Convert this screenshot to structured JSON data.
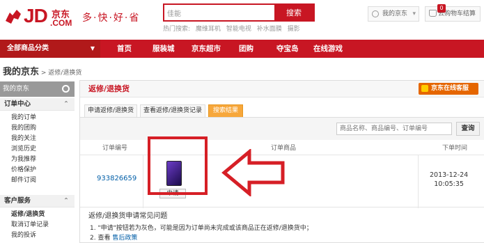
{
  "header": {
    "logo_text": "JD",
    "logo_cn": "京东",
    "logo_com": ".COM",
    "slogan": "多·快·好·省",
    "search_value": "佳能",
    "search_button": "搜索",
    "hot_label": "热门搜索:",
    "hot_words": [
      "魔维耳机",
      "智能电视",
      "补水面膜",
      "摄影"
    ],
    "my_jd": "我的京东",
    "cart": "去购物车结算",
    "cart_count": "0"
  },
  "nav": {
    "all_categories": "全部商品分类",
    "items": [
      "首页",
      "服装城",
      "京东超市",
      "团购",
      "夺宝岛",
      "在线游戏"
    ]
  },
  "breadcrumb": {
    "title": "我的京东",
    "sep": " > ",
    "current": "返修/退换货"
  },
  "sidebar": {
    "head": "我的京东",
    "sections": [
      {
        "label": "订单中心",
        "toggle": "⌃",
        "items": [
          "我的订单",
          "我的团购",
          "我的关注",
          "浏览历史",
          "为我推荐",
          "价格保护",
          "邮件订阅"
        ]
      },
      {
        "label": "客户服务",
        "toggle": "⌃",
        "items": [
          "返修/退换货",
          "取消订单记录",
          "我的投诉"
        ]
      }
    ]
  },
  "main": {
    "title": "返修/退换货",
    "service_button": "京东在线客服",
    "tabs": [
      "申请返修/退换货",
      "查看返修/退换货记录",
      "搜索结果"
    ],
    "search_placeholder": "商品名称、商品编号、订单编号",
    "search_button": "查询",
    "columns": [
      "订单编号",
      "订单商品",
      "下单时间"
    ],
    "order": {
      "id": "933826659",
      "apply_label": "申请",
      "date": "2013-12-24",
      "time": "10:05:35"
    },
    "faq_title": "返修/退换货申请常见问题",
    "faq": [
      {
        "text": "1. \"申请\"按钮若为灰色，可能是因为订单尚未完成或该商品正在返修/退换货中；",
        "link": ""
      },
      {
        "text": "2. 查看 ",
        "link": "售后政策"
      }
    ]
  },
  "colors": {
    "brand": "#c81623",
    "accent": "#f7a73b",
    "service": "#e56600",
    "link": "#005ea7"
  }
}
